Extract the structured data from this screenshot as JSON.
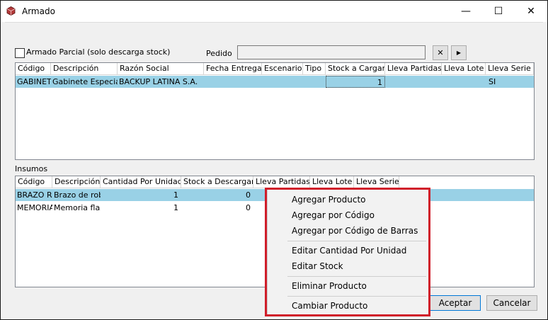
{
  "window": {
    "title": "Armado",
    "minimize_glyph": "—",
    "maximize_glyph": "☐",
    "close_glyph": "✕",
    "icon": "app-cube-icon"
  },
  "form": {
    "partial_label": "Armado Parcial (solo descarga stock)",
    "partial_checked": false,
    "pedido_label": "Pedido",
    "pedido_value": "",
    "clear_glyph": "✕",
    "next_glyph": "▶"
  },
  "pedidos": {
    "columns": [
      "Código",
      "Descripción",
      "Razón Social",
      "Fecha Entrega",
      "Escenario",
      "Tipo",
      "Stock a Cargar",
      "Lleva Partidas",
      "Lleva Lote",
      "Lleva Serie"
    ],
    "rows": [
      [
        "GABINETE",
        "Gabinete Especial",
        "BACKUP LATINA S.A.",
        "",
        "",
        "",
        "1",
        "",
        "",
        "SI"
      ]
    ]
  },
  "insumos": {
    "label": "Insumos",
    "columns": [
      "Código",
      "Descripción",
      "Cantidad Por Unidad",
      "Stock a Descargar",
      "Lleva Partidas",
      "Lleva Lote",
      "Lleva Serie"
    ],
    "rows": [
      [
        "BRAZO R",
        "Brazo de robot",
        "1",
        "0",
        "",
        "",
        ""
      ],
      [
        "MEMORIA",
        "Memoria flash",
        "1",
        "0",
        "",
        "",
        ""
      ]
    ]
  },
  "context_menu": {
    "items": [
      "Agregar Producto",
      "Agregar por Código",
      "Agregar por Código de Barras",
      "Editar Cantidad Por Unidad",
      "Editar Stock",
      "Eliminar Producto",
      "Cambiar Producto"
    ],
    "highlight_color": "#d01e2a"
  },
  "buttons": {
    "accept": "Aceptar",
    "cancel": "Cancelar"
  },
  "colors": {
    "selection": "#99d1e6",
    "window_bg": "#f0f0f0"
  }
}
